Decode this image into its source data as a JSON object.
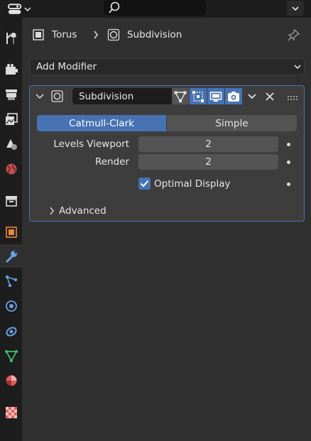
{
  "breadcrumb": {
    "object_name": "Torus",
    "modifier_name": "Subdivision"
  },
  "add_modifier_label": "Add Modifier",
  "modifier": {
    "name": "Subdivision",
    "type_tabs": [
      {
        "label": "Catmull-Clark",
        "selected": true
      },
      {
        "label": "Simple",
        "selected": false
      }
    ],
    "fields": [
      {
        "label": "Levels Viewport",
        "value": "2"
      },
      {
        "label": "Render",
        "value": "2"
      }
    ],
    "optimal_display": {
      "label": "Optimal Display",
      "checked": true
    },
    "advanced_label": "Advanced"
  },
  "colors": {
    "accent": "#4772b3",
    "panel_bg": "#3d3d3d",
    "editor_bg": "#303030",
    "header_bg": "#1d1d1d"
  },
  "property_tabs": [
    "tool",
    "render",
    "output",
    "view-layer",
    "scene",
    "world",
    "collection",
    "object",
    "modifiers",
    "particles",
    "physics",
    "constraints",
    "data",
    "material",
    "texture"
  ],
  "active_tab": "modifiers"
}
